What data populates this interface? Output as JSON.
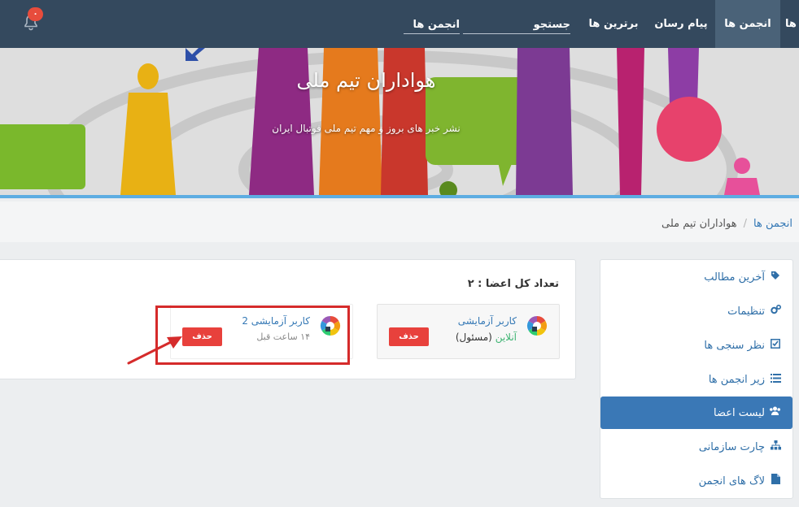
{
  "nav": {
    "edge_label": "ها",
    "forums": "انجمن ها",
    "messenger": "پیام رسان",
    "top": "برترین ها",
    "search": "جستجو",
    "forum_select": "انجمن ها",
    "notification_count": "۰"
  },
  "banner": {
    "title": "هواداران تیم ملی",
    "subtitle": "نشر خبر های بروز و مهم تیم ملی فوتبال ایران"
  },
  "breadcrumb": {
    "root": "انجمن ها",
    "separator": "/",
    "current": "هواداران تیم ملی"
  },
  "sidebar": {
    "items": [
      {
        "label": "آخرین مطالب",
        "icon": "tag-icon"
      },
      {
        "label": "تنظیمات",
        "icon": "gears-icon"
      },
      {
        "label": "نظر سنجی ها",
        "icon": "checkbox-icon"
      },
      {
        "label": "زیر انجمن ها",
        "icon": "list-icon"
      },
      {
        "label": "لیست اعضا",
        "icon": "users-icon",
        "active": true
      },
      {
        "label": "چارت سازمانی",
        "icon": "sitemap-icon"
      },
      {
        "label": "لاگ های انجمن",
        "icon": "file-icon"
      }
    ]
  },
  "members": {
    "title_label": "تعداد کل اعضا",
    "title_sep": " : ",
    "total": "۲",
    "list": [
      {
        "name": "کاربر آزمایشی",
        "status_online": "آنلاین",
        "status_role": " (مسئول)",
        "delete_label": "حذف"
      },
      {
        "name": "کاربر آزمایشی 2",
        "last_seen": "۱۴ ساعت قبل",
        "delete_label": "حذف"
      }
    ]
  },
  "colors": {
    "nav_bg": "#34495e",
    "accent": "#3a78b6",
    "danger": "#e8413c",
    "annotation": "#d52b2b"
  }
}
